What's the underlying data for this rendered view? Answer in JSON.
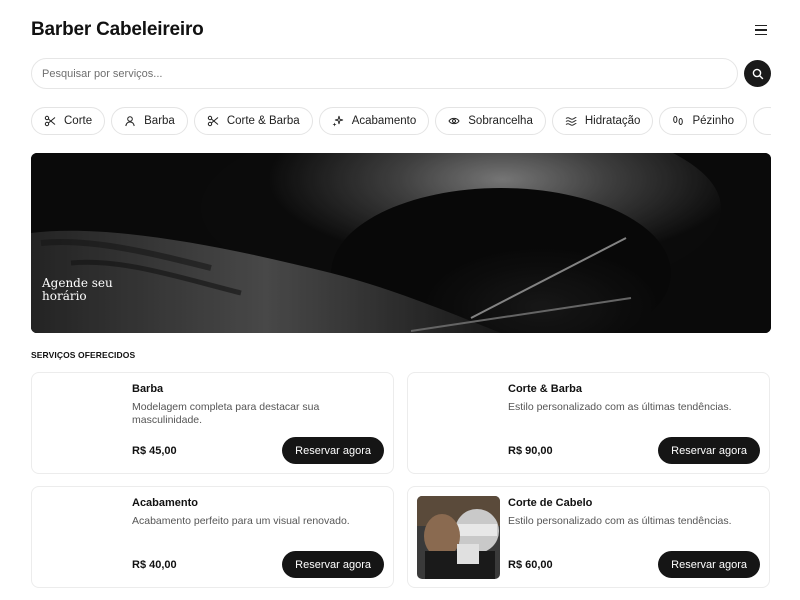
{
  "app": {
    "title": "Barber Cabeleireiro"
  },
  "search": {
    "placeholder": "Pesquisar por serviços..."
  },
  "categories": [
    {
      "label": "Corte",
      "icon": "scissors-icon"
    },
    {
      "label": "Barba",
      "icon": "user-icon"
    },
    {
      "label": "Corte & Barba",
      "icon": "scissors-icon"
    },
    {
      "label": "Acabamento",
      "icon": "sparkles-icon"
    },
    {
      "label": "Sobrancelha",
      "icon": "eye-icon"
    },
    {
      "label": "Hidratação",
      "icon": "waves-icon"
    },
    {
      "label": "Pézinho",
      "icon": "footprints-icon"
    }
  ],
  "hero": {
    "caption": "Agende seu horário"
  },
  "services": {
    "section_title": "SERVIÇOS OFERECIDOS",
    "book_label": "Reservar agora",
    "items": [
      {
        "name": "Barba",
        "description": "Modelagem completa para destacar sua masculinidade.",
        "price": "R$ 45,00"
      },
      {
        "name": "Corte & Barba",
        "description": "Estilo personalizado com as últimas tendências.",
        "price": "R$ 90,00"
      },
      {
        "name": "Acabamento",
        "description": "Acabamento perfeito para um visual renovado.",
        "price": "R$ 40,00"
      },
      {
        "name": "Corte de Cabelo",
        "description": "Estilo personalizado com as últimas tendências.",
        "price": "R$ 60,00"
      }
    ]
  }
}
